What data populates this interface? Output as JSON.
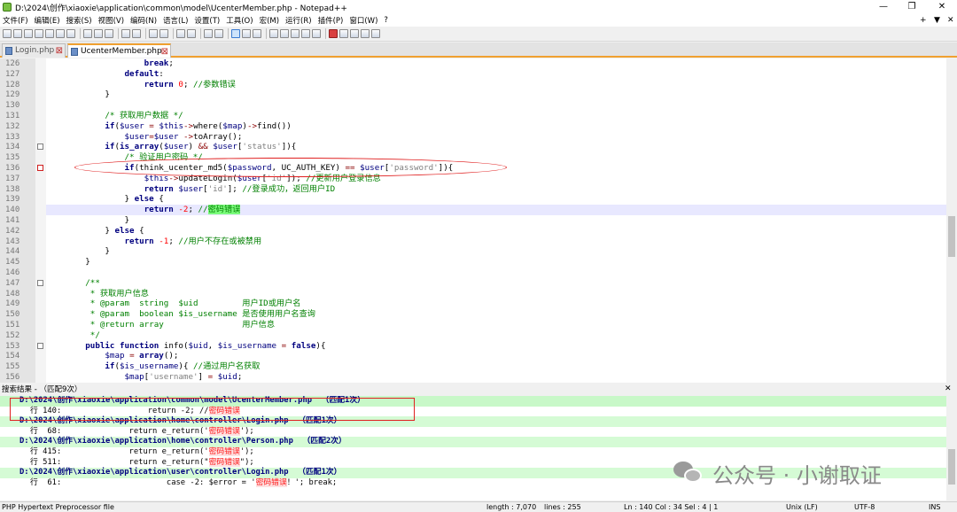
{
  "window": {
    "title": "D:\\2024\\创作\\xiaoxie\\application\\common\\model\\UcenterMember.php - Notepad++",
    "minimize": "—",
    "maximize": "❐",
    "close": "✕"
  },
  "menu": {
    "items": [
      "文件(F)",
      "编辑(E)",
      "搜索(S)",
      "视图(V)",
      "编码(N)",
      "语言(L)",
      "设置(T)",
      "工具(O)",
      "宏(M)",
      "运行(R)",
      "插件(P)",
      "窗口(W)",
      "?"
    ],
    "right_plus": "+",
    "right_down": "▼",
    "right_close": "✕"
  },
  "toolbar": {
    "icons": [
      "new-file-icon",
      "open-file-icon",
      "save-icon",
      "save-all-icon",
      "close-icon",
      "close-all-icon",
      "print-icon",
      "sep",
      "cut-icon",
      "copy-icon",
      "paste-icon",
      "sep",
      "undo-icon",
      "redo-icon",
      "sep",
      "find-icon",
      "replace-icon",
      "sep",
      "zoom-in-icon",
      "zoom-out-icon",
      "sep",
      "sync-vertical-icon",
      "sync-horizontal-icon",
      "sep",
      "word-wrap-icon",
      "show-all-chars-icon",
      "indent-guide-icon",
      "sep",
      "language-icon",
      "doc-map-icon",
      "function-list-icon",
      "folder-workspace-icon",
      "monitor-icon",
      "sep",
      "record-macro-icon",
      "stop-macro-icon",
      "play-macro-icon",
      "run-macro-icon",
      "save-macro-icon"
    ]
  },
  "tabs": [
    {
      "label": "Login.php",
      "active": false,
      "close": "⊠"
    },
    {
      "label": "UcenterMember.php",
      "active": true,
      "close": "⊠"
    }
  ],
  "editor": {
    "current_line": "140",
    "lines": [
      {
        "n": "126",
        "t": "                    break;"
      },
      {
        "n": "127",
        "t": "                default:"
      },
      {
        "n": "128",
        "t": "                    return 0; //参数错误"
      },
      {
        "n": "129",
        "t": "            }"
      },
      {
        "n": "130",
        "t": ""
      },
      {
        "n": "131",
        "t": "            /* 获取用户数据 */"
      },
      {
        "n": "132",
        "t": "            if($user = $this->where($map)->find())"
      },
      {
        "n": "133",
        "t": "                $user=$user ->toArray();"
      },
      {
        "n": "134",
        "t": "            if(is_array($user) && $user['status']){"
      },
      {
        "n": "135",
        "t": "                /* 验证用户密码 */"
      },
      {
        "n": "136",
        "t": "                if(think_ucenter_md5($password, UC_AUTH_KEY) == $user['password']){"
      },
      {
        "n": "137",
        "t": "                    $this->updateLogin($user['id']); //更新用户登录信息"
      },
      {
        "n": "138",
        "t": "                    return $user['id']; //登录成功，返回用户ID"
      },
      {
        "n": "139",
        "t": "                } else {"
      },
      {
        "n": "140",
        "t": "                    return -2; //密码错误"
      },
      {
        "n": "141",
        "t": "                }"
      },
      {
        "n": "142",
        "t": "            } else {"
      },
      {
        "n": "143",
        "t": "                return -1; //用户不存在或被禁用"
      },
      {
        "n": "144",
        "t": "            }"
      },
      {
        "n": "145",
        "t": "        }"
      },
      {
        "n": "146",
        "t": ""
      },
      {
        "n": "147",
        "t": "        /**"
      },
      {
        "n": "148",
        "t": "         * 获取用户信息"
      },
      {
        "n": "149",
        "t": "         * @param  string  $uid         用户ID或用户名"
      },
      {
        "n": "150",
        "t": "         * @param  boolean $is_username 是否使用用户名查询"
      },
      {
        "n": "151",
        "t": "         * @return array                用户信息"
      },
      {
        "n": "152",
        "t": "         */"
      },
      {
        "n": "153",
        "t": "        public function info($uid, $is_username = false){"
      },
      {
        "n": "154",
        "t": "            $map = array();"
      },
      {
        "n": "155",
        "t": "            if($is_username){ //通过用户名获取"
      },
      {
        "n": "156",
        "t": "                $map['username'] = $uid;"
      }
    ]
  },
  "find_results": {
    "title": "搜索结果 - （匹配9次）",
    "close": "✕",
    "rows": [
      {
        "kind": "file",
        "text": "D:\\2024\\创作\\xiaoxie\\application\\common\\model\\UcenterMember.php  （匹配1次）"
      },
      {
        "kind": "hit",
        "prefix": "行 140:",
        "pre": "                return -2; //",
        "match": "密码错误",
        "post": ""
      },
      {
        "kind": "file",
        "text": "D:\\2024\\创作\\xiaoxie\\application\\home\\controller\\Login.php  （匹配1次）"
      },
      {
        "kind": "hit",
        "prefix": "行  68:",
        "pre": "            return e_return('",
        "match": "密码错误",
        "post": "');"
      },
      {
        "kind": "file",
        "text": "D:\\2024\\创作\\xiaoxie\\application\\home\\controller\\Person.php  （匹配2次）"
      },
      {
        "kind": "hit",
        "prefix": "行 415:",
        "pre": "            return e_return('",
        "match": "密码错误",
        "post": "');"
      },
      {
        "kind": "hit",
        "prefix": "行 511:",
        "pre": "            return e_return(\"",
        "match": "密码错误",
        "post": "\");"
      },
      {
        "kind": "file",
        "text": "D:\\2024\\创作\\xiaoxie\\application\\user\\controller\\Login.php  （匹配1次）"
      },
      {
        "kind": "hit",
        "prefix": "行  61:",
        "pre": "                    case -2: $error = '",
        "match": "密码错误",
        "post": "！'; break;"
      }
    ]
  },
  "watermark": "公众号 · 小谢取证",
  "status": {
    "language": "PHP Hypertext Preprocessor file",
    "length": "length : 7,070",
    "lines": "lines : 255",
    "position": "Ln : 140   Col : 34   Sel : 4 | 1",
    "eol": "Unix (LF)",
    "encoding": "UTF-8",
    "mode": "INS"
  },
  "colors": {
    "accent": "#f0a030",
    "annotation": "#e02020",
    "match_bg": "#7cfc7c",
    "file_row_bg": "#d5fbd5"
  }
}
